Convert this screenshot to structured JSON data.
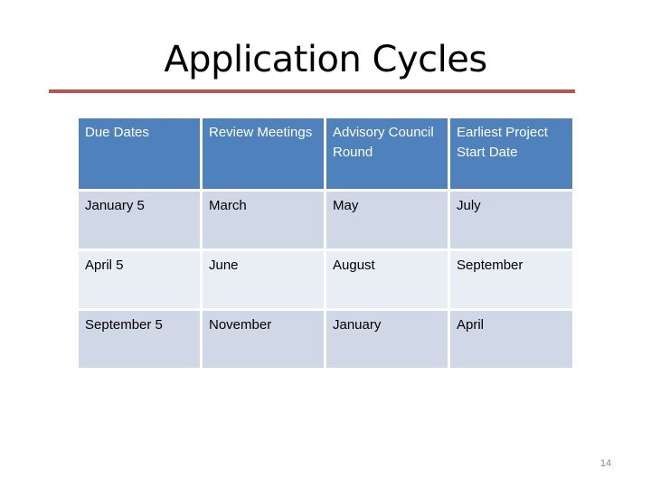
{
  "slide": {
    "title": "Application Cycles",
    "page_number": "14",
    "accent_rule_color": "#b85450"
  },
  "table": {
    "header_color": "#4f81bd",
    "row_colors": [
      "#d0d8e8",
      "#e9edf4"
    ],
    "headers": [
      "Due Dates",
      "Review Meetings",
      "Advisory Council Round",
      "Earliest Project Start Date"
    ],
    "rows": [
      [
        "January 5",
        "March",
        "May",
        "July"
      ],
      [
        "April 5",
        "June",
        "August",
        "September"
      ],
      [
        "September 5",
        "November",
        "January",
        "April"
      ]
    ]
  }
}
